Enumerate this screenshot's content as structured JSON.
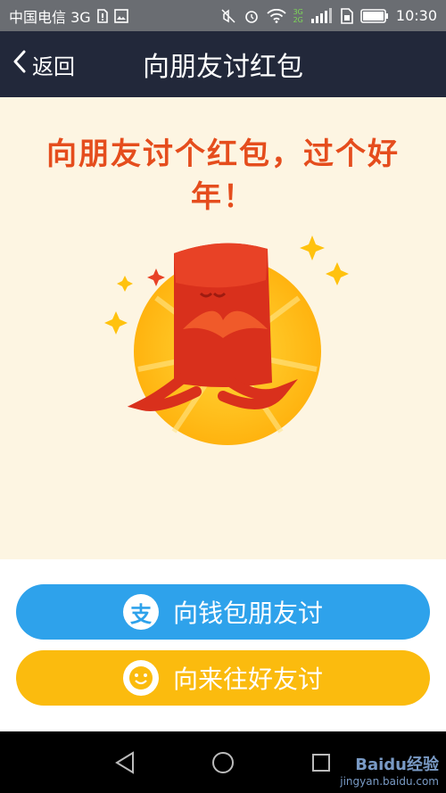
{
  "status_bar": {
    "carrier": "中国电信 3G",
    "time": "10:30",
    "net_badge_top": "3G",
    "net_badge_bottom": "2G"
  },
  "nav": {
    "back_label": "返回",
    "title": "向朋友讨红包"
  },
  "content": {
    "headline": "向朋友讨个红包，过个好年！",
    "background_color": "#fdf5e2",
    "headline_color": "#e54d1d"
  },
  "actions": {
    "alipay_button_label": "向钱包朋友讨",
    "alipay_icon_glyph": "支",
    "alipay_color": "#2ea2eb",
    "laiwang_button_label": "向来往好友讨",
    "laiwang_color": "#fbbb0e"
  },
  "system_nav": {
    "icons": [
      "back-triangle-icon",
      "home-circle-icon",
      "recent-square-icon"
    ]
  },
  "watermark": {
    "brand": "Baidu经验",
    "url": "jingyan.baidu.com"
  }
}
